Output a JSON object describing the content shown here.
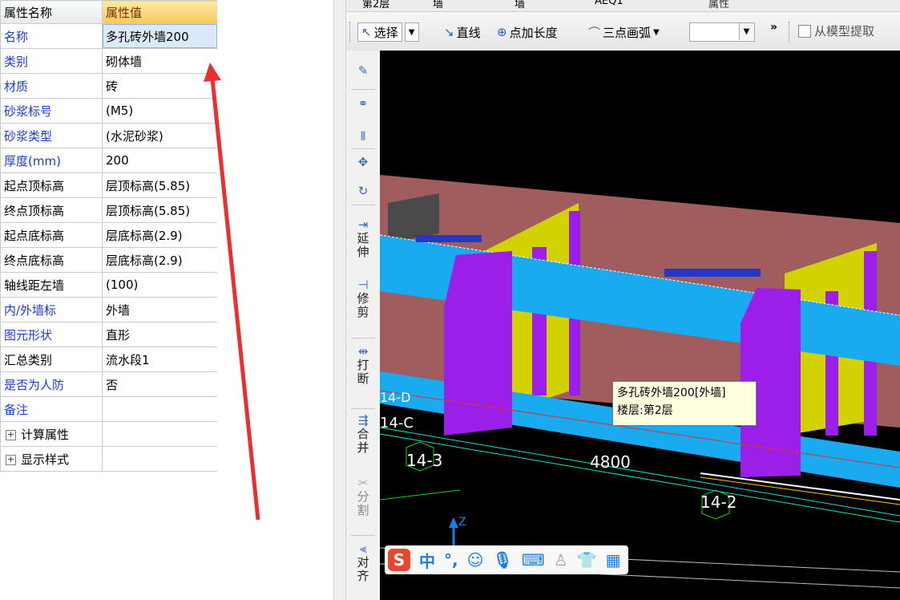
{
  "property_panel": {
    "header": {
      "name_col": "属性名称",
      "value_col": "属性值"
    },
    "rows": [
      {
        "name": "名称",
        "value": "多孔砖外墙200",
        "style": "blue"
      },
      {
        "name": "类别",
        "value": "砌体墙",
        "style": "blue"
      },
      {
        "name": "材质",
        "value": "砖",
        "style": "blue"
      },
      {
        "name": "砂浆标号",
        "value": "(M5)",
        "style": "blue"
      },
      {
        "name": "砂浆类型",
        "value": "(水泥砂浆)",
        "style": "blue"
      },
      {
        "name": "厚度(mm)",
        "value": "200",
        "style": "blue"
      },
      {
        "name": "起点顶标高",
        "value": "层顶标高(5.85)",
        "style": "black"
      },
      {
        "name": "终点顶标高",
        "value": "层顶标高(5.85)",
        "style": "black"
      },
      {
        "name": "起点底标高",
        "value": "层底标高(2.9)",
        "style": "black"
      },
      {
        "name": "终点底标高",
        "value": "层底标高(2.9)",
        "style": "black"
      },
      {
        "name": "轴线距左墙",
        "value": "(100)",
        "style": "black"
      },
      {
        "name": "内/外墙标",
        "value": "外墙",
        "style": "blue"
      },
      {
        "name": "图元形状",
        "value": "直形",
        "style": "blue"
      },
      {
        "name": "汇总类别",
        "value": "流水段1",
        "style": "black"
      },
      {
        "name": "是否为人防",
        "value": "否",
        "style": "blue"
      },
      {
        "name": "备注",
        "value": "",
        "style": "blue"
      }
    ],
    "groups": [
      {
        "name": "计算属性",
        "expander": "+"
      },
      {
        "name": "显示样式",
        "expander": "+"
      }
    ]
  },
  "top_toolbar": {
    "partial_items": [
      "第2层",
      "墙",
      "墙",
      "AEQ1",
      "属性"
    ]
  },
  "draw_toolbar": {
    "select_label": "选择",
    "line_label": "直线",
    "point_length_label": "点加长度",
    "arc_label": "三点画弧",
    "more_label": "»",
    "extract_label": "从模型提取"
  },
  "side_toolbar": {
    "extend_label": "延伸",
    "trim_label": "修剪",
    "break_label": "打断",
    "merge_label": "合并",
    "split_label": "分割",
    "align_label": "对齐"
  },
  "viewport": {
    "axis_labels": [
      "14-3",
      "14-2",
      "14-C",
      "14-D"
    ],
    "dimension_label": "4800",
    "z_axis_label": "Z",
    "colors": {
      "background": "#000000",
      "wall": "#a15d5d",
      "beam": "#19aaf0",
      "column": "#9b1fe8",
      "yellow_wall": "#d2d200"
    }
  },
  "tooltip": {
    "line1": "多孔砖外墙200[外墙]",
    "line2": "楼层:第2层"
  },
  "ime_toolbar": {
    "logo": "S",
    "mode_label": "中",
    "punct_label": "°,",
    "icons": [
      "smiley-icon",
      "microphone-icon",
      "keyboard-icon",
      "user-icon",
      "shirt-icon",
      "grid-icon"
    ]
  }
}
